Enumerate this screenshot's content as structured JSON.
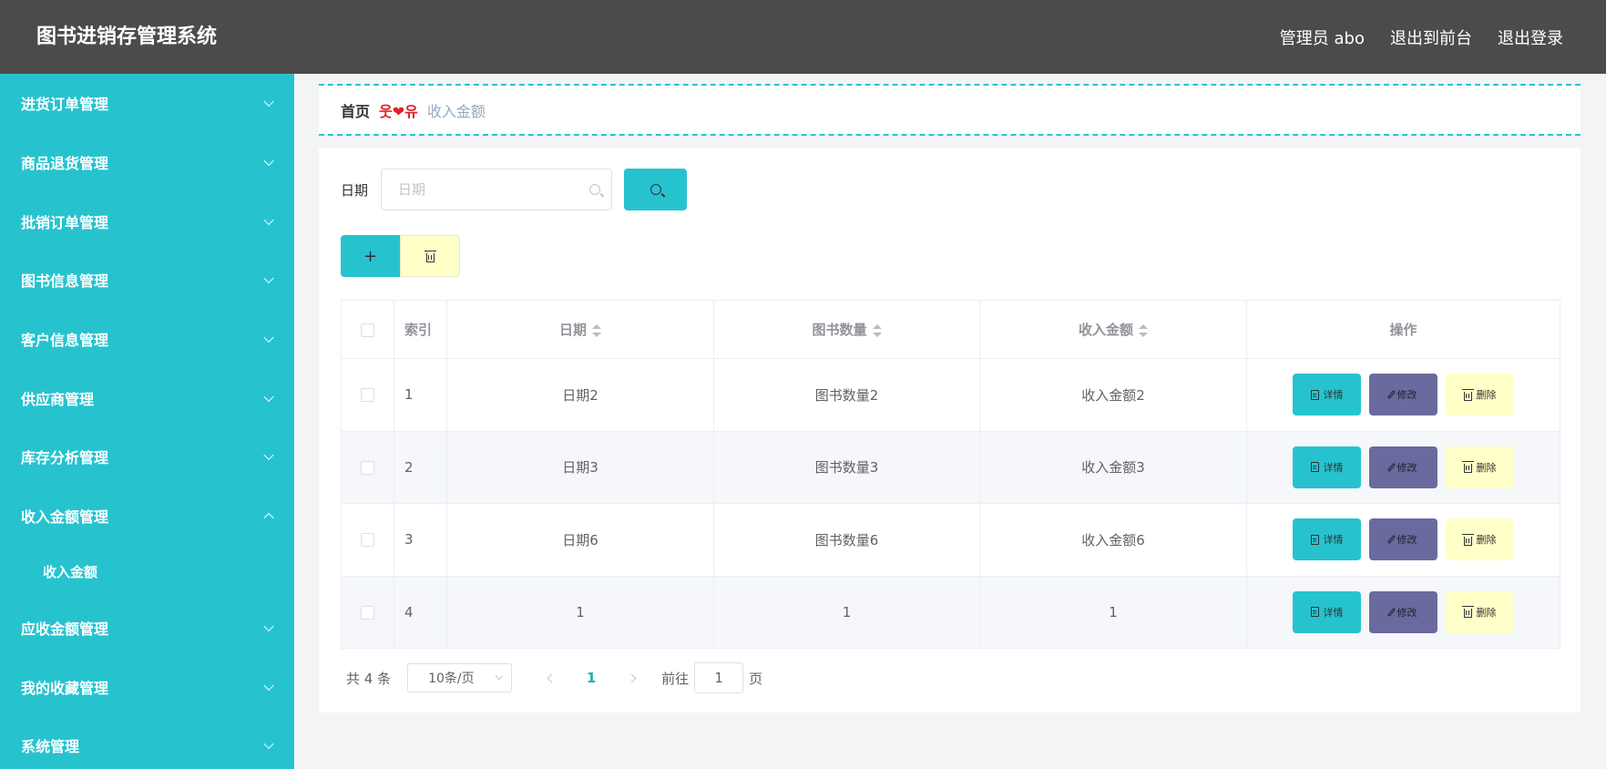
{
  "header": {
    "app_title": "图书进销存管理系统",
    "admin_label": "管理员 abo",
    "front_label": "退出到前台",
    "logout_label": "退出登录"
  },
  "sidebar": {
    "items": [
      {
        "label": "进货订单管理",
        "expanded": false
      },
      {
        "label": "商品退货管理",
        "expanded": false
      },
      {
        "label": "批销订单管理",
        "expanded": false
      },
      {
        "label": "图书信息管理",
        "expanded": false
      },
      {
        "label": "客户信息管理",
        "expanded": false
      },
      {
        "label": "供应商管理",
        "expanded": false
      },
      {
        "label": "库存分析管理",
        "expanded": false
      },
      {
        "label": "收入金额管理",
        "expanded": true
      },
      {
        "label": "应收金额管理",
        "expanded": false
      },
      {
        "label": "我的收藏管理",
        "expanded": false
      },
      {
        "label": "系统管理",
        "expanded": false
      }
    ],
    "sub_item": "收入金额"
  },
  "breadcrumb": {
    "home": "首页",
    "separator": "웃❤유",
    "current": "收入金额"
  },
  "search": {
    "label": "日期",
    "placeholder": "日期"
  },
  "table": {
    "headers": {
      "index": "索引",
      "date": "日期",
      "book_count": "图书数量",
      "income": "收入金额",
      "actions": "操作"
    },
    "rows": [
      {
        "index": "1",
        "date": "日期2",
        "book_count": "图书数量2",
        "income": "收入金额2"
      },
      {
        "index": "2",
        "date": "日期3",
        "book_count": "图书数量3",
        "income": "收入金额3"
      },
      {
        "index": "3",
        "date": "日期6",
        "book_count": "图书数量6",
        "income": "收入金额6"
      },
      {
        "index": "4",
        "date": "1",
        "book_count": "1",
        "income": "1"
      }
    ],
    "action_labels": {
      "detail": "详情",
      "edit": "修改",
      "delete": "删除"
    }
  },
  "pagination": {
    "total": "共 4 条",
    "page_size": "10条/页",
    "current_page": "1",
    "goto_label": "前往",
    "goto_value": "1",
    "goto_suffix": "页"
  },
  "colors": {
    "header_bg": "#4b4b4b",
    "accent": "#26c3cf",
    "edit_button": "#6a6a9f",
    "delete_button": "#ffffc8",
    "page_active": "#1bb2a7"
  },
  "icons": {
    "search": "search-icon",
    "add": "plus-icon",
    "delete": "trash-icon",
    "detail": "document-icon",
    "edit": "pencil-icon"
  }
}
